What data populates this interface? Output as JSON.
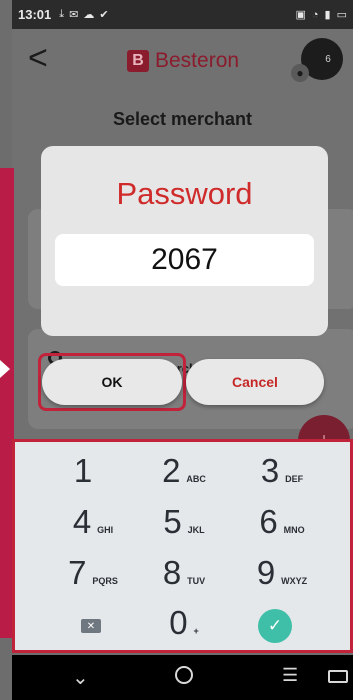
{
  "status_bar": {
    "time": "13:01"
  },
  "header": {
    "back_icon": "arrow-back-icon",
    "logo_text": "Besteron",
    "avatar_count": "6"
  },
  "page": {
    "title": "Select merchant"
  },
  "merchants": [
    {
      "subtitle": ""
    },
    {
      "subtitle": "(Merchant 1)"
    }
  ],
  "dialog": {
    "title": "Password",
    "value": "2067",
    "ok_label": "OK",
    "cancel_label": "Cancel"
  },
  "keypad": {
    "keys": [
      {
        "digit": "1",
        "letters": ""
      },
      {
        "digit": "2",
        "letters": "ABC"
      },
      {
        "digit": "3",
        "letters": "DEF"
      },
      {
        "digit": "4",
        "letters": "GHI"
      },
      {
        "digit": "5",
        "letters": "JKL"
      },
      {
        "digit": "6",
        "letters": "MNO"
      },
      {
        "digit": "7",
        "letters": "PQRS"
      },
      {
        "digit": "8",
        "letters": "TUV"
      },
      {
        "digit": "9",
        "letters": "WXYZ"
      },
      {
        "digit": "0",
        "letters": "+"
      }
    ]
  },
  "colors": {
    "accent": "#b91d47",
    "dialog_title": "#cf2b2b",
    "confirm": "#3fbfa8"
  }
}
